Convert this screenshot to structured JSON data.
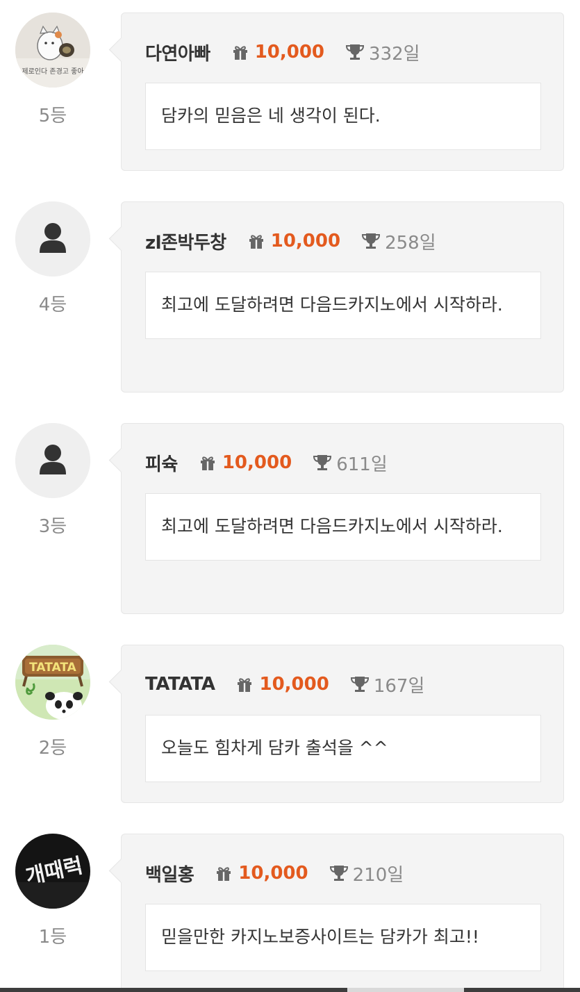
{
  "entries": [
    {
      "rank": "5등",
      "nickname": "다연아빠",
      "points": "10,000",
      "days": "332일",
      "message": "담카의 믿음은 네 생각이 된다.",
      "avatar": "avatar-photo-sketch",
      "avatar_text": "제로인다 존경고 좋아"
    },
    {
      "rank": "4등",
      "nickname": "zl존박두창",
      "points": "10,000",
      "days": "258일",
      "message": "최고에 도달하려면 다음드카지노에서 시작하라.",
      "avatar": "default-user-icon"
    },
    {
      "rank": "3등",
      "nickname": "피슉",
      "points": "10,000",
      "days": "611일",
      "message": "최고에 도달하려면 다음드카지노에서 시작하라.",
      "avatar": "default-user-icon"
    },
    {
      "rank": "2등",
      "nickname": "TATATA",
      "points": "10,000",
      "days": "167일",
      "message": "오늘도 힘차게 담카 출석을 ^^",
      "avatar": "avatar-panda-sign",
      "avatar_text": "TATATA"
    },
    {
      "rank": "1등",
      "nickname": "백일홍",
      "points": "10,000",
      "days": "210일",
      "message": "믿을만한 카지노보증사이트는 담카가 최고!!",
      "avatar": "avatar-dark-sign",
      "avatar_text": "개때럭"
    }
  ],
  "colors": {
    "points": "#e35a1e",
    "nickname": "#333333",
    "muted": "#8a8a8a",
    "card_bg": "#f4f4f4"
  },
  "icons": {
    "gift": "gift-icon",
    "trophy": "trophy-icon"
  }
}
